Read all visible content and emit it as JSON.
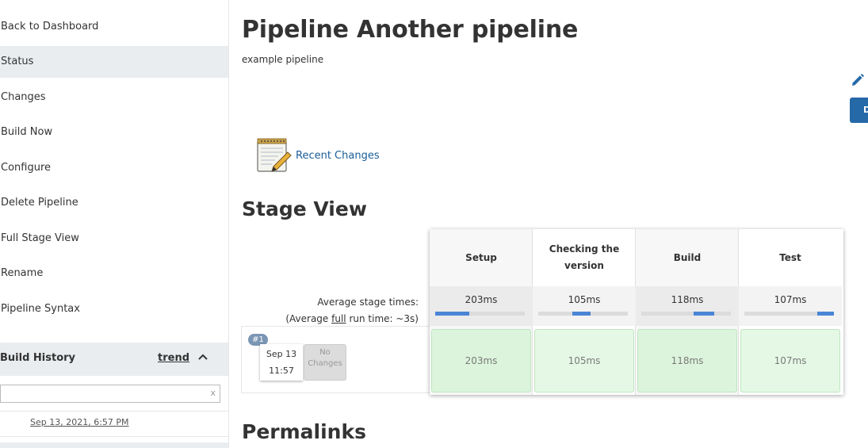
{
  "sidebar": {
    "items": [
      {
        "label": "Back to Dashboard"
      },
      {
        "label": "Status"
      },
      {
        "label": "Changes"
      },
      {
        "label": "Build Now"
      },
      {
        "label": "Configure"
      },
      {
        "label": "Delete Pipeline"
      },
      {
        "label": "Full Stage View"
      },
      {
        "label": "Rename"
      },
      {
        "label": "Pipeline Syntax"
      }
    ],
    "active_item": "Status",
    "build_history": {
      "title": "Build History",
      "trend_label": "trend",
      "filter_value": "",
      "clear_label": "x",
      "entries": [
        {
          "label": "Sep 13, 2021, 6:57 PM"
        }
      ]
    }
  },
  "main": {
    "title": "Pipeline Another pipeline",
    "description": "example pipeline",
    "right_button_label": "D",
    "recent_changes_label": "Recent Changes",
    "stage_view_heading": "Stage View",
    "permalinks_heading": "Permalinks"
  },
  "stage_view": {
    "avg_label_line1": "Average stage times:",
    "avg_label_prefix": "(Average ",
    "avg_label_full": "full",
    "avg_label_suffix": " run time: ~3s)",
    "stages": [
      {
        "name": "Setup",
        "avg": "203ms",
        "bar_start": 0.0,
        "bar_width": 0.38
      },
      {
        "name": "Checking the version",
        "avg": "105ms",
        "bar_start": 0.38,
        "bar_width": 0.2
      },
      {
        "name": "Build",
        "avg": "118ms",
        "bar_start": 0.58,
        "bar_width": 0.23
      },
      {
        "name": "Test",
        "avg": "107ms",
        "bar_start": 0.81,
        "bar_width": 0.19
      }
    ],
    "builds": [
      {
        "number": "#1",
        "date": "Sep 13",
        "time": "11:57",
        "changes": "No Changes",
        "durations": [
          "203ms",
          "105ms",
          "118ms",
          "107ms"
        ]
      }
    ]
  },
  "colors": {
    "accent_link": "#1a5c98",
    "primary_button": "#2569a8",
    "success_cell": "#e2f6e2",
    "sidebar_active": "#e9edf0",
    "progress_bar": "#4a85d6"
  }
}
